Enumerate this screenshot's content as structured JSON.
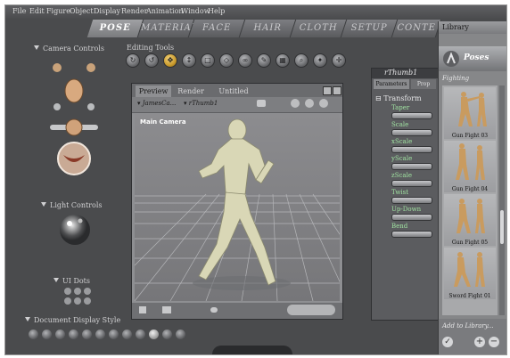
{
  "menu": [
    "File",
    "Edit",
    "Figure",
    "Object",
    "Display",
    "Render",
    "Animation",
    "Window",
    "Help"
  ],
  "room_tabs": [
    "POSE",
    "MATERIAL",
    "FACE",
    "HAIR",
    "CLOTH",
    "SETUP",
    "CONTE"
  ],
  "active_tab": "POSE",
  "left_panel": {
    "camera_controls": "Camera Controls",
    "light_controls": "Light Controls",
    "ui_dots": "UI Dots",
    "document_display_style": "Document Display Style"
  },
  "editing_tools": {
    "label": "Editing Tools",
    "tools": [
      "rotate-icon",
      "twist-icon",
      "translate-icon",
      "translate-in-out-icon",
      "scale-icon",
      "taper-icon",
      "chain-break-icon",
      "color-icon",
      "grouping-icon",
      "view-magnifier-icon",
      "morphing-icon",
      "direct-manipulation-icon"
    ]
  },
  "viewport": {
    "tabs": [
      "Preview",
      "Render"
    ],
    "document_title": "Untitled",
    "figure_select": "JamesCa...",
    "part_select": "rThumb1",
    "camera_label": "Main Camera"
  },
  "parameters": {
    "title": "rThumb1",
    "tabs": [
      "Parameters",
      "Prop"
    ],
    "section": "Transform",
    "dials": [
      "Taper",
      "Scale",
      "xScale",
      "yScale",
      "zScale",
      "Twist",
      "Up-Down",
      "Bend"
    ]
  },
  "library": {
    "title": "Library",
    "category": "Poses",
    "subcategory": "Fighting",
    "items": [
      "Gun Fight 03",
      "Gun Fight 04",
      "Gun Fight 05",
      "Sword Fight 01"
    ],
    "add_label": "Add to Library..."
  },
  "colors": {
    "accent": "#e0b040",
    "panel": "#4a4b4d",
    "parameter_label": "#9fe0a0"
  }
}
